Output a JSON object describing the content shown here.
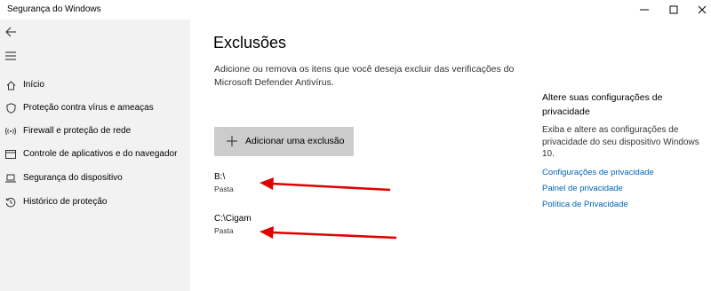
{
  "window": {
    "title": "Segurança do Windows",
    "controls": [
      "minimize",
      "maximize",
      "close"
    ]
  },
  "sidebar": {
    "back_icon": "back-arrow-icon",
    "menu_icon": "hamburger-icon",
    "items": [
      {
        "label": "Início",
        "icon": "home-icon"
      },
      {
        "label": "Proteção contra vírus e ameaças",
        "icon": "shield-icon"
      },
      {
        "label": "Firewall e proteção de rede",
        "icon": "wireless-icon"
      },
      {
        "label": "Controle de aplicativos e do navegador",
        "icon": "app-window-icon"
      },
      {
        "label": "Segurança do dispositivo",
        "icon": "laptop-icon"
      },
      {
        "label": "Histórico de proteção",
        "icon": "history-icon"
      }
    ]
  },
  "main": {
    "title": "Exclusões",
    "description": "Adicione ou remova os itens que você deseja excluir das verificações do Microsoft Defender Antivírus.",
    "add_button_label": "Adicionar uma exclusão",
    "exclusions": [
      {
        "path": "B:\\",
        "type": "Pasta"
      },
      {
        "path": "C:\\Cigam",
        "type": "Pasta"
      }
    ]
  },
  "privacy_panel": {
    "title": "Altere suas configurações de privacidade",
    "description": "Exiba e altere as configurações de privacidade do seu dispositivo Windows 10.",
    "links": [
      "Configurações de privacidade",
      "Painel de privacidade",
      "Política de Privacidade"
    ]
  },
  "colors": {
    "sidebar_bg": "#f2f2f2",
    "button_bg": "#cccccc",
    "link": "#0066b4",
    "annotation_arrow": "#e00000"
  }
}
